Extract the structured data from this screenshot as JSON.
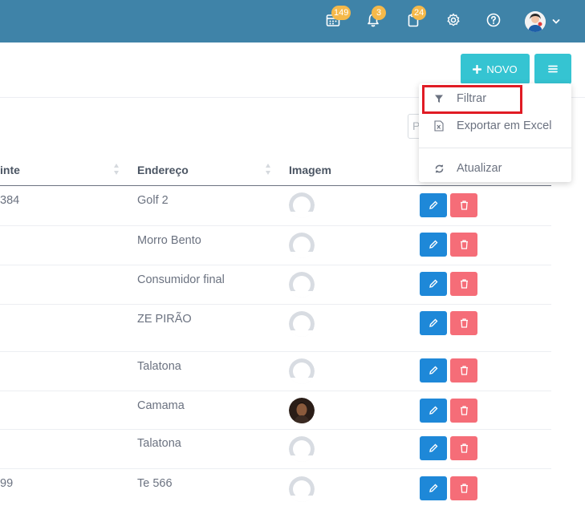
{
  "topbar": {
    "badges": {
      "calendar": "149",
      "notifications": "3",
      "documents": "24"
    },
    "icons": [
      "calendar-icon",
      "bell-icon",
      "clipboard-icon",
      "gear-icon",
      "help-icon"
    ]
  },
  "toolbar": {
    "new_label": "NOVO"
  },
  "search": {
    "placeholder": "P"
  },
  "table": {
    "columns": [
      "inte",
      "Endereço",
      "Imagem"
    ],
    "rows": [
      {
        "partial": "384",
        "address": "Golf 2",
        "image": "default-avatar"
      },
      {
        "partial": "",
        "address": "Morro Bento",
        "image": "default-avatar"
      },
      {
        "partial": "",
        "address": "Consumidor final",
        "image": "default-avatar"
      },
      {
        "partial": "",
        "address": "ZE PIRÃO",
        "image": "default-avatar"
      },
      {
        "partial": "",
        "address": "Talatona",
        "image": "default-avatar"
      },
      {
        "partial": "",
        "address": "Camama",
        "image": "photo"
      },
      {
        "partial": "",
        "address": "Talatona",
        "image": "default-avatar"
      },
      {
        "partial": "99",
        "address": "Te 566",
        "image": "default-avatar"
      }
    ]
  },
  "dropdown": {
    "items": [
      {
        "label": "Filtrar",
        "icon": "filter-icon"
      },
      {
        "label": "Exportar em Excel",
        "icon": "excel-icon"
      },
      {
        "label": "Atualizar",
        "icon": "refresh-icon"
      }
    ]
  },
  "colors": {
    "topbar": "#3f83a8",
    "accent": "#35c4d2",
    "edit": "#1e88d8",
    "delete": "#f56d78",
    "badge": "#f5b94a",
    "highlight": "#e01b24"
  }
}
